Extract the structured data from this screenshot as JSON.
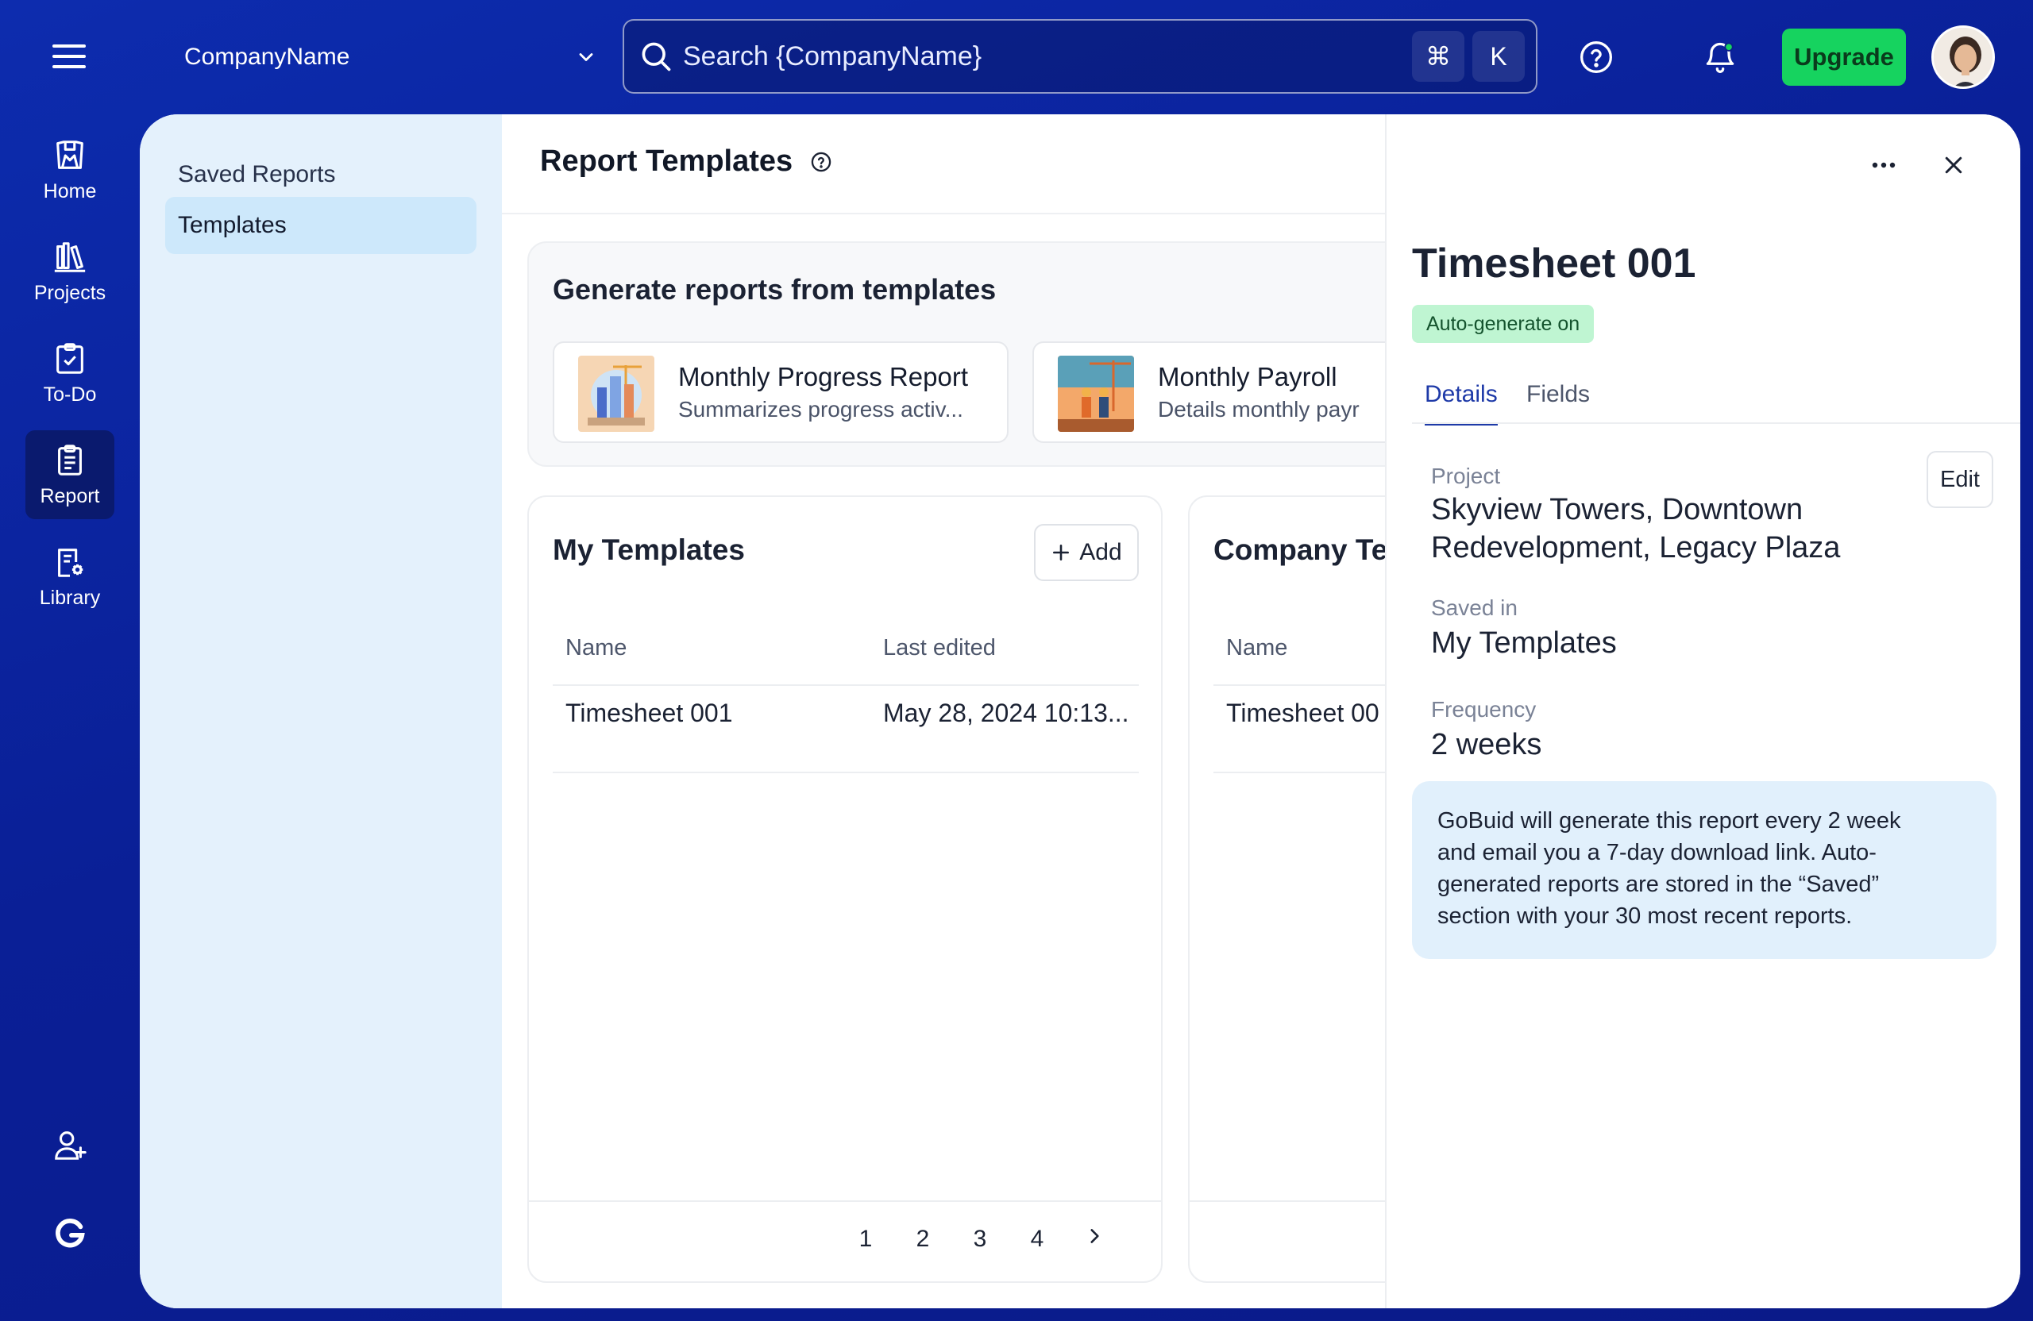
{
  "topbar": {
    "company": "CompanyName",
    "search_placeholder": "Search {CompanyName}",
    "shortcut_cmd": "⌘",
    "shortcut_key": "K",
    "upgrade_label": "Upgrade",
    "accent_green": "#16d35f"
  },
  "rail": {
    "items": [
      {
        "label": "Home",
        "icon": "home-icon"
      },
      {
        "label": "Projects",
        "icon": "projects-icon"
      },
      {
        "label": "To-Do",
        "icon": "todo-icon"
      },
      {
        "label": "Report",
        "icon": "report-icon",
        "active": true
      },
      {
        "label": "Library",
        "icon": "library-icon"
      }
    ],
    "bottom": [
      "add-user-icon",
      "brand-logo-icon"
    ]
  },
  "subnav": {
    "items": [
      {
        "label": "Saved Reports"
      },
      {
        "label": "Templates",
        "active": true
      }
    ]
  },
  "main": {
    "title": "Report Templates",
    "generate": {
      "title": "Generate reports from templates",
      "cards": [
        {
          "name": "Monthly Progress Report",
          "desc": "Summarizes progress activ..."
        },
        {
          "name": "Monthly Payroll",
          "desc": "Details monthly payr"
        }
      ]
    },
    "my_templates": {
      "title": "My Templates",
      "add_label": "Add",
      "columns": [
        "Name",
        "Last edited"
      ],
      "rows": [
        {
          "name": "Timesheet 001",
          "edited": "May 28, 2024 10:13..."
        }
      ],
      "pages": [
        "1",
        "2",
        "3",
        "4"
      ]
    },
    "company_templates": {
      "title": "Company Te",
      "columns": [
        "Name"
      ],
      "rows": [
        {
          "name": "Timesheet 00"
        }
      ]
    }
  },
  "drawer": {
    "title": "Timesheet 001",
    "badge": "Auto-generate on",
    "tabs": [
      "Details",
      "Fields"
    ],
    "edit_label": "Edit",
    "project_label": "Project",
    "project_value_line1": "Skyview Towers, Downtown",
    "project_value_line2": "Redevelopment, Legacy Plaza",
    "saved_in_label": "Saved in",
    "saved_in_value": "My Templates",
    "frequency_label": "Frequency",
    "frequency_value": "2 weeks",
    "info_line1": "GoBuid will generate this report every 2 week",
    "info_line2": "and email you a 7-day download link. Auto-",
    "info_line3": "generated reports are stored in the “Saved”",
    "info_line4": "section with your 30 most recent reports."
  }
}
